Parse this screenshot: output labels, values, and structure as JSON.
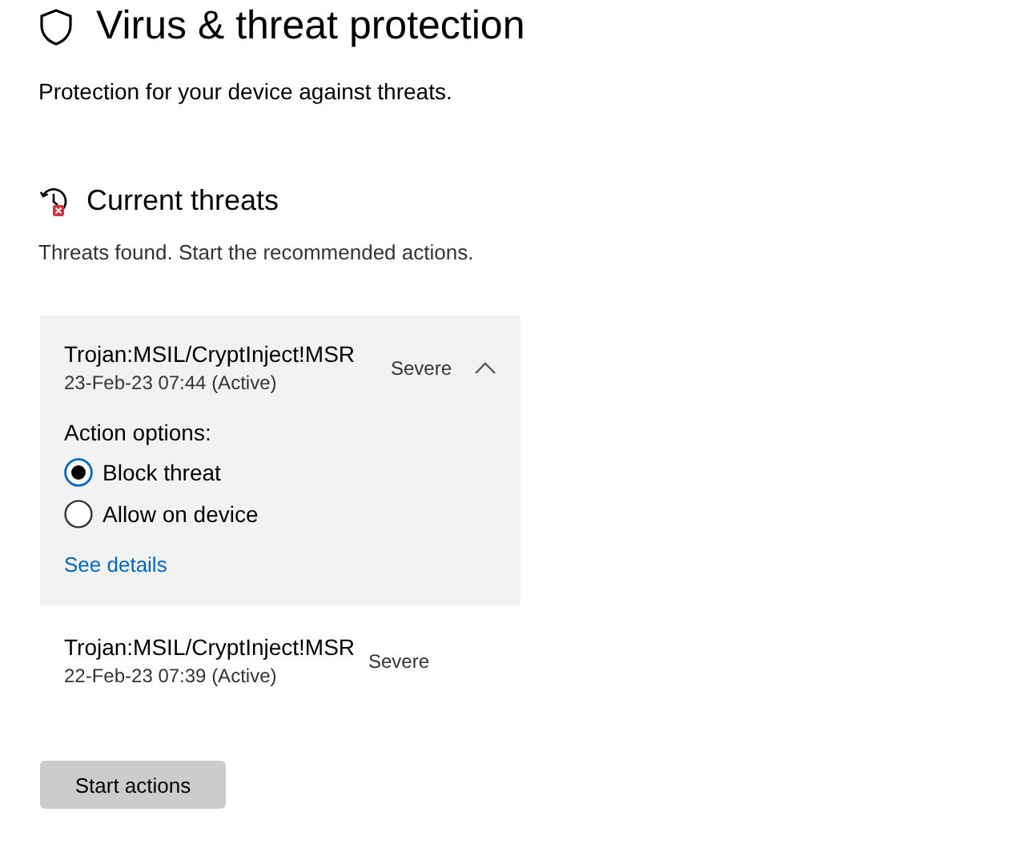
{
  "page": {
    "title": "Virus & threat protection",
    "subtitle": "Protection for your device against threats."
  },
  "section": {
    "title": "Current threats",
    "description": "Threats found. Start the recommended actions."
  },
  "threats": [
    {
      "name": "Trojan:MSIL/CryptInject!MSR",
      "detail": "23-Feb-23 07:44 (Active)",
      "severity": "Severe",
      "expanded": true,
      "options_label": "Action options:",
      "options": [
        {
          "label": "Block threat",
          "selected": true
        },
        {
          "label": "Allow on device",
          "selected": false
        }
      ],
      "link": "See details"
    },
    {
      "name": "Trojan:MSIL/CryptInject!MSR",
      "detail": "22-Feb-23 07:39 (Active)",
      "severity": "Severe",
      "expanded": false
    }
  ],
  "button": "Start actions"
}
